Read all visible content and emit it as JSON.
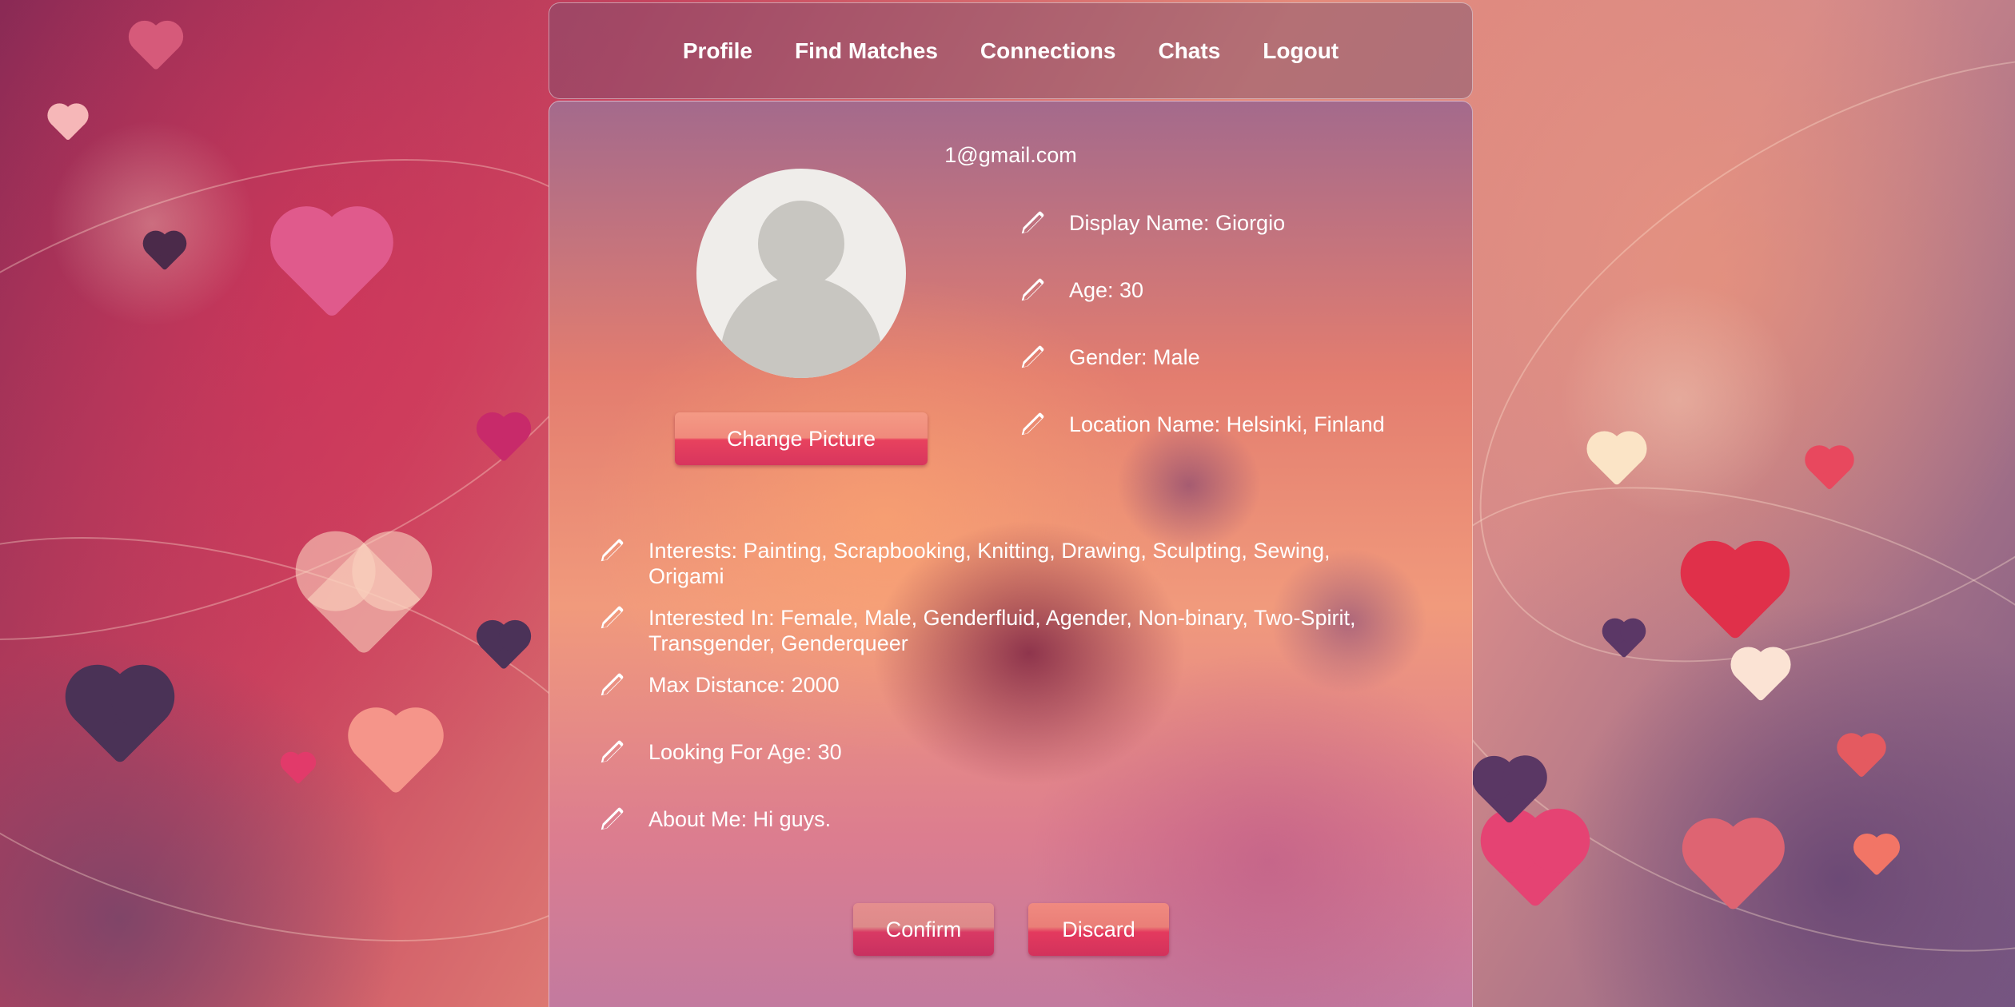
{
  "nav": {
    "items": [
      "Profile",
      "Find Matches",
      "Connections",
      "Chats",
      "Logout"
    ]
  },
  "profile": {
    "email": "1@gmail.com",
    "change_picture_label": "Change Picture",
    "fields_right": [
      "Display Name: Giorgio",
      "Age: 30",
      "Gender: Male",
      "Location Name: Helsinki, Finland"
    ],
    "fields_bottom": [
      "Interests: Painting, Scrapbooking, Knitting, Drawing, Sculpting, Sewing, Origami",
      "Interested In: Female, Male, Genderfluid, Agender, Non-binary, Two-Spirit, Transgender, Genderqueer",
      "Max Distance: 2000",
      "Looking For Age: 30",
      "About Me: Hi guys."
    ],
    "confirm_label": "Confirm",
    "discard_label": "Discard"
  },
  "colors": {
    "button_top": "#f49a85",
    "button_bottom": "#d8355e",
    "text": "#ffffff"
  }
}
